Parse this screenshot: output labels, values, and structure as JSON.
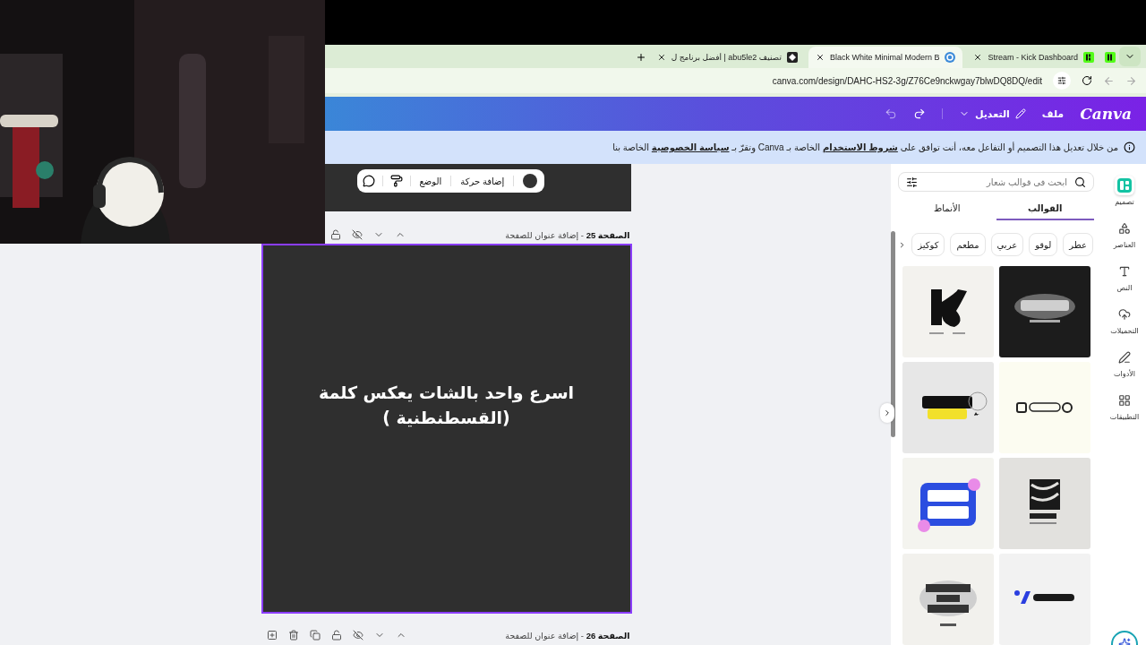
{
  "browser_tabs": [
    {
      "title": "Stream - Kick Dashboard",
      "selected": false
    },
    {
      "title": "Black White Minimal Modern B",
      "selected": true
    },
    {
      "title": "تصنيف abu5le2 | أفضل برنامج ل",
      "selected": false
    }
  ],
  "address_bar": {
    "url": "canva.com/design/DAHC-HS2-3g/Z76Ce9nckwgay7blwDQ8DQ/edit"
  },
  "canva_header": {
    "logo": "Canva",
    "menu": [
      {
        "label": "ملف",
        "kind": "plain"
      },
      {
        "label": "التعديل",
        "kind": "edit"
      }
    ]
  },
  "notice": {
    "parts": [
      {
        "text": "من خلال تعديل هذا التصميم أو التفاعل معه، أنت توافق على ",
        "kind": "text"
      },
      {
        "text": "شروط الاستخدام",
        "kind": "link"
      },
      {
        "text": " الخاصة بـ Canva وتقرّ بـ ",
        "kind": "text"
      },
      {
        "text": "سياسة الخصوصية",
        "kind": "link"
      },
      {
        "text": " الخاصة بنا",
        "kind": "text"
      }
    ]
  },
  "floating_toolbar": {
    "items": [
      {
        "kind": "swatch",
        "color": "#333333"
      },
      {
        "kind": "label",
        "label": "إضافة حركة"
      },
      {
        "kind": "label",
        "label": "الوضع"
      },
      {
        "kind": "roller"
      },
      {
        "kind": "comment"
      }
    ]
  },
  "current_page": {
    "header": "**الصفحة 25** - إضافة عنوان للصفحة",
    "text": "اسرع واحد بالشات يعكس كلمة\n(القسطنطنية )",
    "selected": true
  },
  "next_page": {
    "header": "**الصفحة 26** - إضافة عنوان للصفحة"
  },
  "panel": {
    "search": {
      "placeholder": "ابحث في قوالب شعار"
    },
    "tabs": [
      {
        "label": "القوالب",
        "selected": true
      },
      {
        "label": "الأنماط",
        "selected": false
      }
    ],
    "chips": [
      "عطر",
      "لوقو",
      "عربي",
      "مطعم",
      "كوكيز"
    ],
    "templates": [
      {
        "kind": "picture"
      },
      {
        "kind": "picture"
      },
      {
        "kind": "picture"
      },
      {
        "kind": "picture"
      },
      {
        "kind": "picture"
      },
      {
        "kind": "picture"
      },
      {
        "kind": "picture"
      },
      {
        "kind": "picture"
      }
    ]
  },
  "rail": [
    {
      "label": "تصميم",
      "selected": true
    },
    {
      "label": "العناصر",
      "selected": false
    },
    {
      "label": "النص",
      "selected": false
    },
    {
      "label": "التحميلات",
      "selected": false
    },
    {
      "label": "الأدوات",
      "selected": false
    },
    {
      "label": "التطبيقات",
      "selected": false
    }
  ],
  "webcam": {
    "kind": "picture"
  }
}
